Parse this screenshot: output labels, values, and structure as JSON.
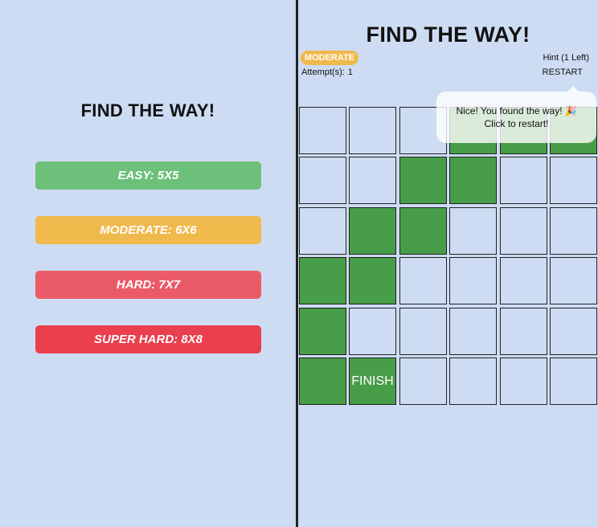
{
  "left": {
    "title": "FIND THE WAY!",
    "levels": [
      {
        "label": "EASY: 5X5",
        "color": "#6cc07a"
      },
      {
        "label": "MODERATE: 6X6",
        "color": "#f0b94c"
      },
      {
        "label": "HARD: 7X7",
        "color": "#ea5b67"
      },
      {
        "label": "SUPER HARD: 8X8",
        "color": "#ea3f4c"
      }
    ]
  },
  "game": {
    "title": "FIND THE WAY!",
    "difficulty": "MODERATE",
    "attempts_label": "Attempt(s):",
    "attempts_value": "1",
    "hint_label": "Hint (1 Left)",
    "restart_label": "RESTART",
    "grid_size": 6,
    "path_cells": [
      [
        0,
        3
      ],
      [
        0,
        4
      ],
      [
        0,
        5
      ],
      [
        1,
        2
      ],
      [
        1,
        3
      ],
      [
        2,
        1
      ],
      [
        2,
        2
      ],
      [
        3,
        0
      ],
      [
        3,
        1
      ],
      [
        4,
        0
      ],
      [
        5,
        0
      ],
      [
        5,
        1
      ]
    ],
    "finish_cell": [
      5,
      1
    ],
    "finish_label": "FINISH",
    "path_color": "#489d48"
  },
  "toast": {
    "line1": "Nice! You found the way!",
    "line2": "Click to restart!",
    "icon": "party-popper-icon"
  }
}
